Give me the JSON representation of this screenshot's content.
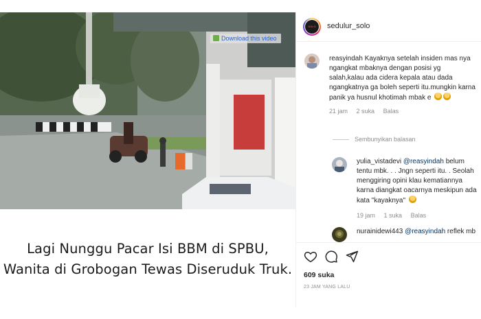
{
  "media": {
    "download_badge": "Download this video",
    "caption_line1": "Lagi Nunggu Pacar Isi BBM di SPBU,",
    "caption_line2": "Wanita di Grobogan Tewas Diseruduk Truk."
  },
  "header": {
    "username": "sedulur_solo",
    "avatar_icon": "account-logo-icon"
  },
  "comments": [
    {
      "username": "reasyindah",
      "text": "Kayaknya setelah insiden mas nya ngangkat mbaknya dengan posisi yg salah,kalau ada cidera kepala atau dada ngangkatnya ga boleh seperti itu.mungkin karna panik ya husnul khotimah mbak e",
      "time": "21 jam",
      "likes": "2 suka",
      "reply": "Balas",
      "avatar_color": "#d9c9c1"
    },
    {
      "username": "yulia_vistadevi",
      "mention": "@reasyindah",
      "text": "belum tentu mbk. . . Jngn seperti itu. . Seolah menggiring opini klau kematiannya karna diangkat oacarnya meskipun ada kata \"kayaknya\"",
      "time": "19 jam",
      "likes": "1 suka",
      "reply": "Balas",
      "avatar_color": "#aab4c0"
    },
    {
      "username": "nurainidewi443",
      "mention": "@reasyindah",
      "text": "reflek mb",
      "avatar_color": "#3d3a1d"
    }
  ],
  "hide_replies": "Sembunyikan balasan",
  "actions": {
    "like_icon": "heart-icon",
    "comment_icon": "comment-icon",
    "share_icon": "share-icon",
    "likes": "609 suka",
    "time": "23 JAM YANG LALU"
  }
}
